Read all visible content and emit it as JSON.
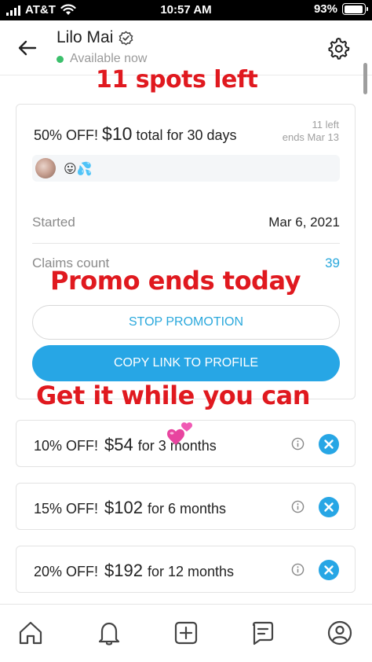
{
  "status_bar": {
    "carrier": "AT&T",
    "time": "10:57 AM",
    "battery": "93%",
    "battery_level": 0.93
  },
  "header": {
    "name": "Lilo Mai",
    "presence": "Available now",
    "icons": [
      "arrow-left-icon",
      "verified-icon",
      "gear-icon"
    ]
  },
  "overlays": {
    "top": "11 spots left",
    "middle": "Promo ends today",
    "bottom": "Get it while you can"
  },
  "promo": {
    "discount": "50% OFF!",
    "price": "$10",
    "duration": "total for 30 days",
    "spots": "11 left",
    "ends": "ends Mar 13",
    "emoji": "😛💦",
    "started_label": "Started",
    "started_value": "Mar 6, 2021",
    "claims_label": "Claims count",
    "claims_value": "39",
    "stop_label": "STOP PROMOTION",
    "copy_label": "COPY LINK TO PROFILE"
  },
  "offers": [
    {
      "discount": "10% OFF!",
      "price": "$54",
      "duration": "for 3 months"
    },
    {
      "discount": "15% OFF!",
      "price": "$102",
      "duration": "for 6 months"
    },
    {
      "discount": "20% OFF!",
      "price": "$192",
      "duration": "for 12 months"
    }
  ],
  "bottom_nav": {
    "icons": [
      "home-icon",
      "bell-icon",
      "plus-square-icon",
      "message-icon",
      "profile-icon"
    ]
  },
  "colors": {
    "accent": "#27a6e5",
    "overlay_red": "#e0191f",
    "available_green": "#3cc06c"
  }
}
